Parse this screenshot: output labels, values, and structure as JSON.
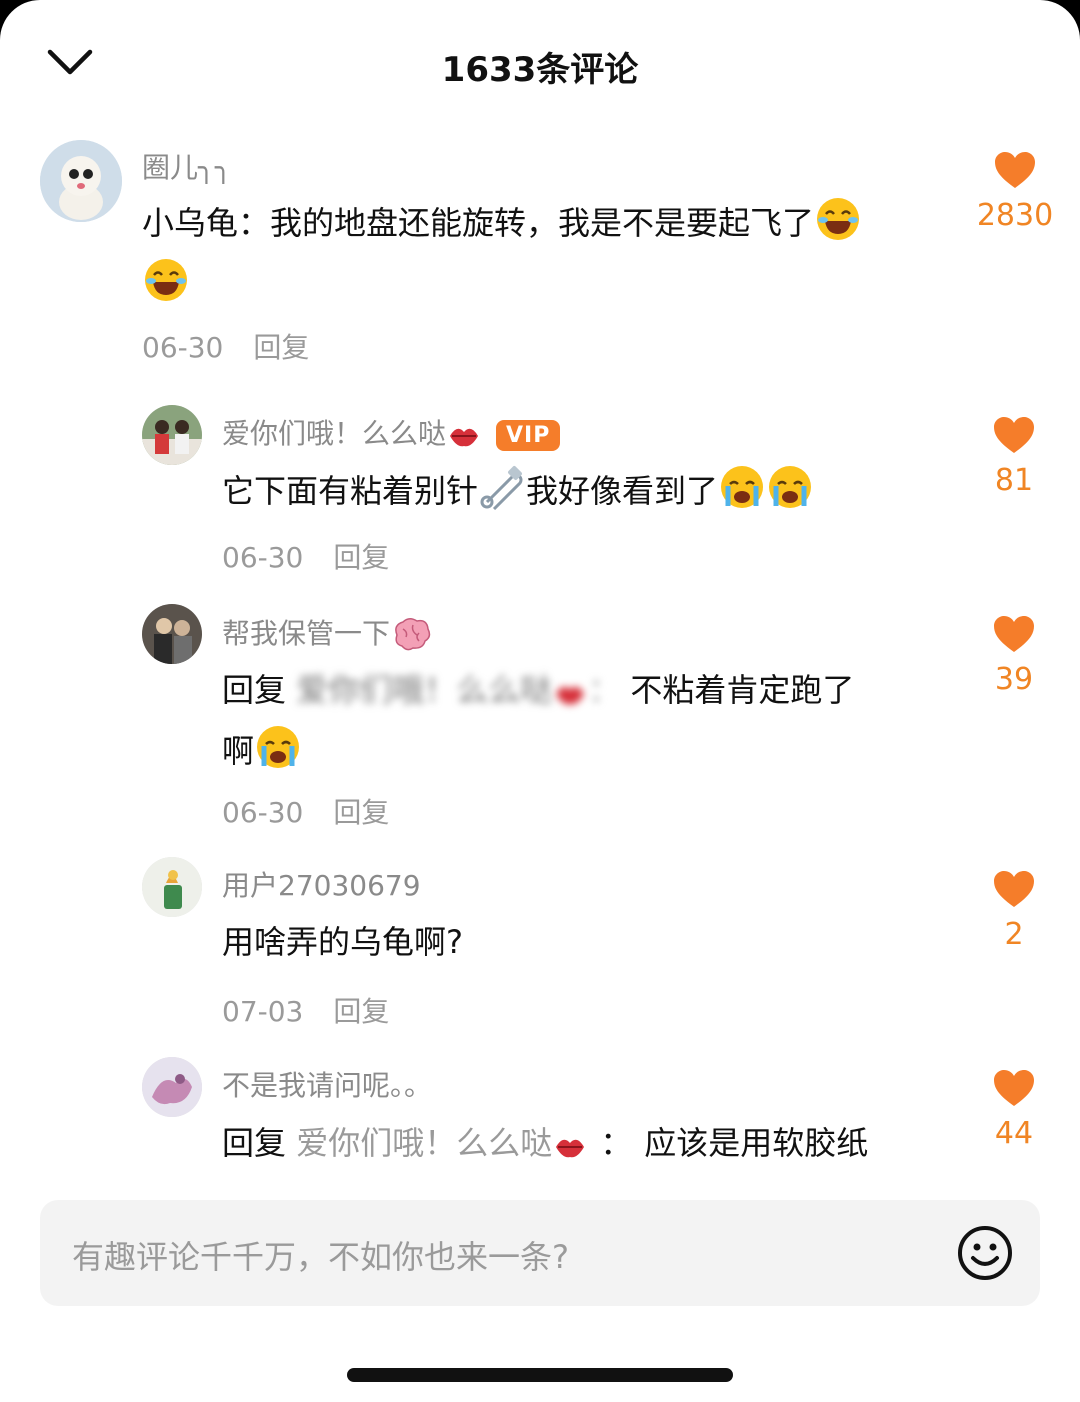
{
  "header": {
    "title": "1633条评论",
    "collapse_icon": "chevron-down-icon"
  },
  "comments": [
    {
      "username": "圈儿╮╮",
      "text": "小乌龟：我的地盘还能旋转，我是不是要起飞了",
      "date": "06-30",
      "reply_label": "回复",
      "likes": "2830"
    },
    {
      "username": "爱你们哦！么么哒",
      "badge": "VIP",
      "text_a": "它下面有粘着别针",
      "text_b": "我好像看到了",
      "date": "06-30",
      "reply_label": "回复",
      "likes": "81"
    },
    {
      "username": "帮我保管一下",
      "reply_prefix": "回复",
      "mention": "爱你们哦！么么哒",
      "separator": "：",
      "text": "不粘着肯定跑了",
      "text_cont": "啊",
      "date": "06-30",
      "reply_label": "回复",
      "likes": "39"
    },
    {
      "username": "用户27030679",
      "text": "用啥弄的乌龟啊?",
      "date": "07-03",
      "reply_label": "回复",
      "likes": "2"
    },
    {
      "username": "不是我请问呢。。",
      "reply_prefix": "回复",
      "mention": "爱你们哦！么么哒",
      "separator": "：",
      "text": "应该是用软胶纸",
      "likes": "44"
    }
  ],
  "input": {
    "placeholder": "有趣评论千千万，不如你也来一条?",
    "emoji_icon": "smiley-icon"
  },
  "colors": {
    "accent": "#f08524",
    "heart": "#f57d2a",
    "muted": "#9a9a9a"
  }
}
